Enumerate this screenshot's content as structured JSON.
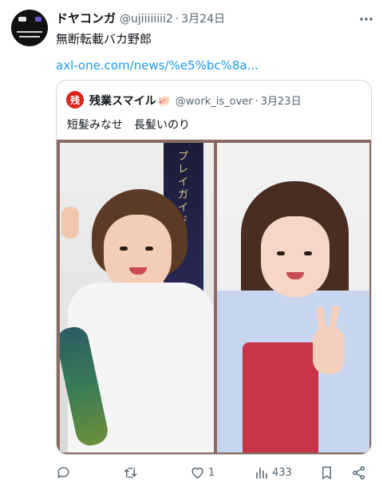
{
  "tweet": {
    "display_name": "ドヤコンガ",
    "handle": "@ujiiiiiiii2",
    "separator": "·",
    "date": "3月24日",
    "text": "無断転載バカ野郎",
    "link": "axl-one.com/news/%e5%bc%8a..."
  },
  "quoted": {
    "avatar_char": "残",
    "display_name": "残業スマイル",
    "name_emoji": "🐖",
    "handle": "@work_is_over",
    "separator": "·",
    "date": "3月23日",
    "text": "短髪みなせ　長髪いのり",
    "banner_text": "プレイガイド"
  },
  "actions": {
    "reply_count": "",
    "retweet_count": "",
    "like_count": "1",
    "views_count": "433"
  },
  "icons": {
    "more": "more-icon",
    "reply": "reply-icon",
    "retweet": "retweet-icon",
    "like": "heart-icon",
    "views": "views-icon",
    "bookmark": "bookmark-icon",
    "share": "share-icon"
  }
}
